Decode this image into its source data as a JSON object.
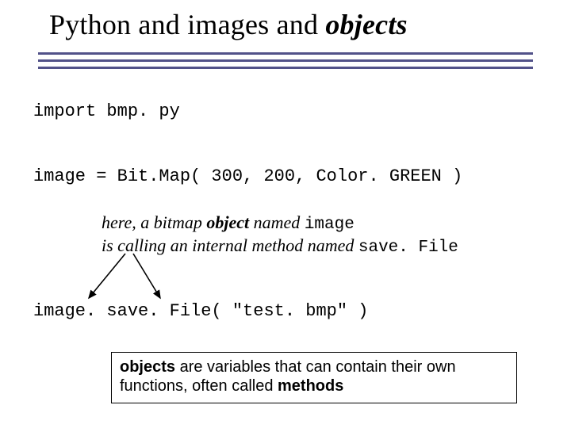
{
  "title": {
    "prefix": "Python and images and ",
    "emphasis": "objects"
  },
  "code": {
    "import_line": "import bmp. py",
    "assign_line": "image = Bit.Map( 300, 200, Color. GREEN )",
    "call_line": "image. save. File( \"test. bmp\" )"
  },
  "note": {
    "line1_prefix": "here, a bitmap ",
    "line1_obj": "object",
    "line1_mid": " named ",
    "line1_mono": "image",
    "line2_prefix": "is calling an internal method named ",
    "line2_mono": "save. File"
  },
  "box": {
    "b1": "objects",
    "mid": " are variables that can contain their own functions, often called ",
    "b2": "methods"
  }
}
